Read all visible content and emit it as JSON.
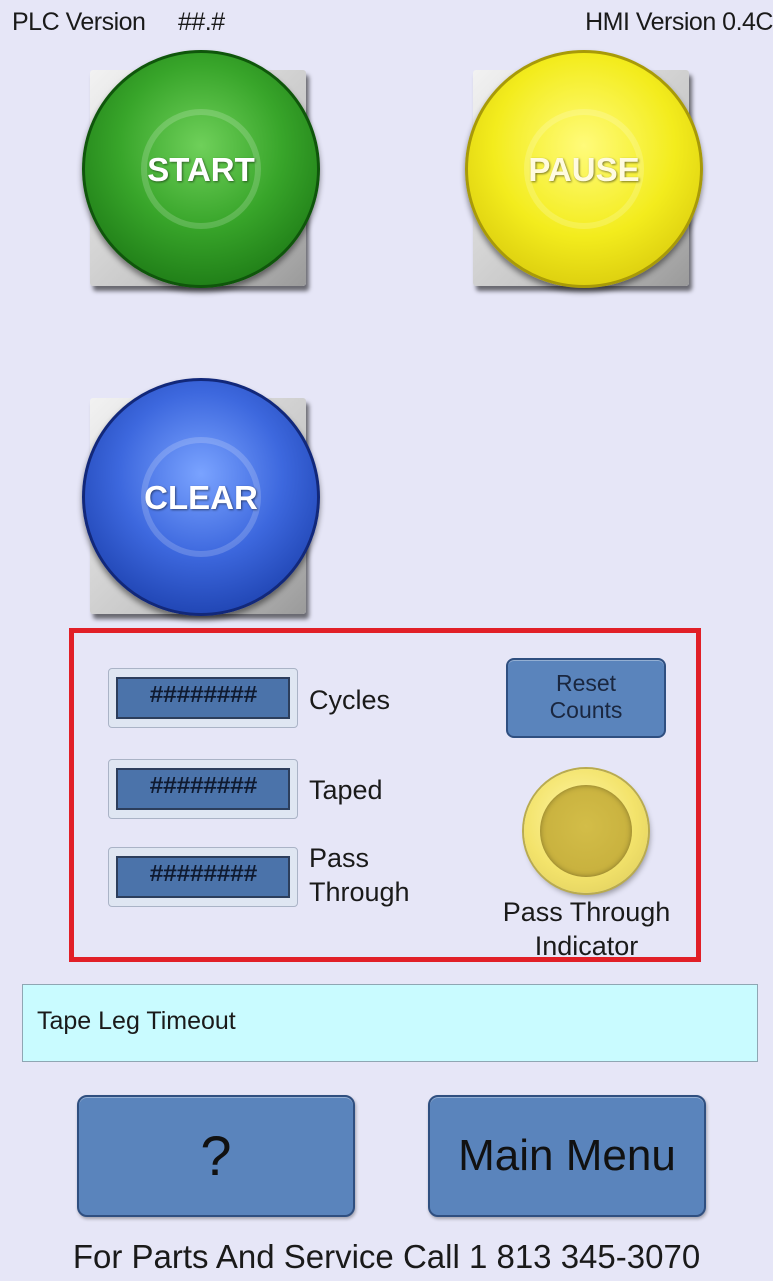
{
  "header": {
    "plc_label": "PLC Version",
    "plc_value": "##.#",
    "hmi_version": "HMI Version 0.4C"
  },
  "buttons": {
    "start": "START",
    "pause": "PAUSE",
    "clear": "CLEAR"
  },
  "counts": {
    "cycles": {
      "value": "########",
      "label": "Cycles"
    },
    "taped": {
      "value": "########",
      "label": "Taped"
    },
    "pass_through": {
      "value": "########",
      "label_line1": "Pass",
      "label_line2": "Through"
    },
    "reset_line1": "Reset",
    "reset_line2": "Counts",
    "indicator_line1": "Pass Through",
    "indicator_line2": "Indicator"
  },
  "status": {
    "message": "Tape Leg Timeout"
  },
  "nav": {
    "help_label": "?",
    "main_menu_label": "Main Menu"
  },
  "footer": {
    "text": "For Parts And Service Call 1 813 345-3070"
  },
  "colors": {
    "background": "#e6e6f7",
    "start": "#38a52a",
    "pause": "#f3ec1d",
    "clear": "#3d68de",
    "panel_border": "#e11f27",
    "button_blue": "#5a84bc",
    "status_bg": "#c9fbff",
    "indicator": "#f3e36b"
  }
}
